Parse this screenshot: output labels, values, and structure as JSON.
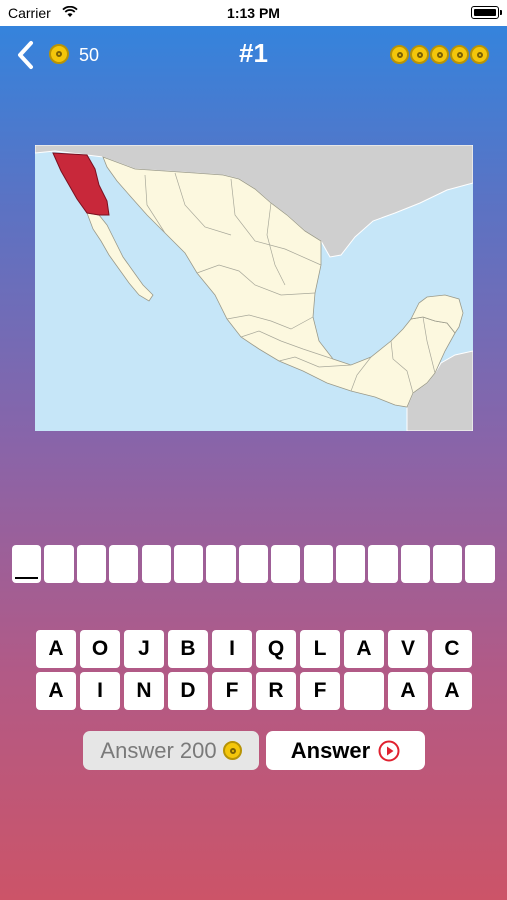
{
  "status_bar": {
    "carrier": "Carrier",
    "time": "1:13 PM"
  },
  "header": {
    "coins": "50",
    "level": "#1",
    "progress_coins": 5
  },
  "map": {
    "country": "Mexico",
    "highlight_color": "#c8283a",
    "land_color": "#fcf8df",
    "water_color": "#c6e6f8",
    "neighbor_color": "#cfcfcf"
  },
  "answer": {
    "slot_count": 15,
    "active_slot": 1
  },
  "keyboard": {
    "rows": [
      [
        "A",
        "O",
        "J",
        "B",
        "I",
        "Q",
        "L",
        "A",
        "V",
        "C"
      ],
      [
        "A",
        "I",
        "N",
        "D",
        "F",
        "R",
        "F",
        "",
        "A",
        "A"
      ]
    ]
  },
  "actions": {
    "coin_answer_label": "Answer 200",
    "video_answer_label": "Answer"
  }
}
